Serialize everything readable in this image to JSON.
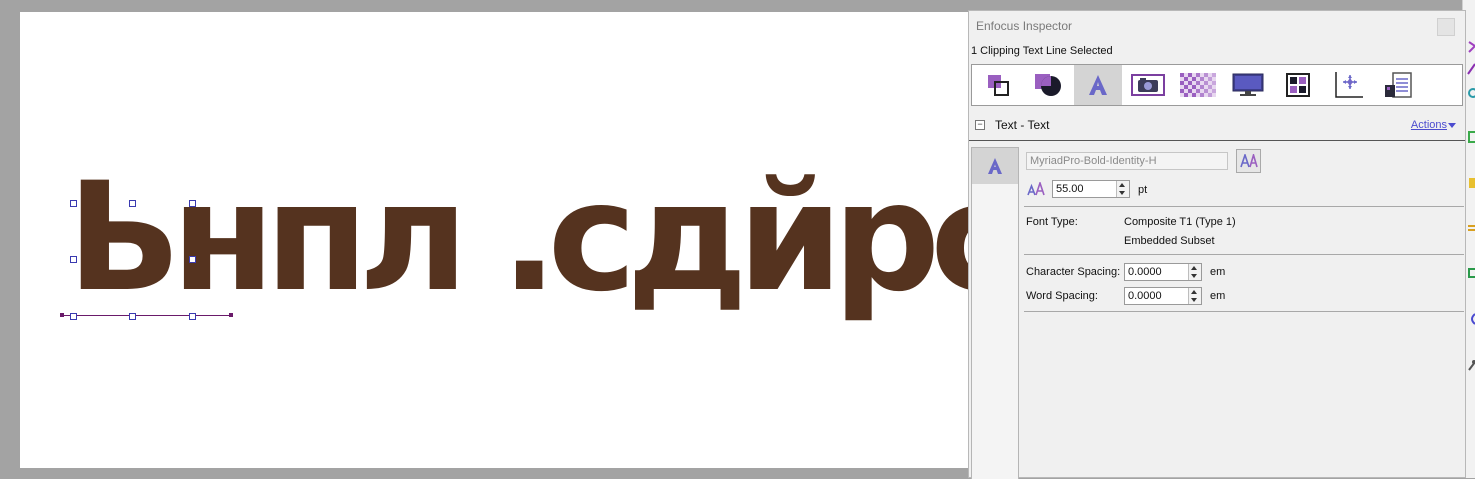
{
  "document": {
    "text": "Ьнпл .сдйрс",
    "text_color": "#55331f"
  },
  "inspector": {
    "title": "Enfocus Inspector",
    "selection_info": "1 Clipping Text Line Selected",
    "tabs": [
      {
        "name": "object-icon"
      },
      {
        "name": "fill-stroke-icon"
      },
      {
        "name": "text-icon",
        "active": true
      },
      {
        "name": "image-icon"
      },
      {
        "name": "transparency-icon"
      },
      {
        "name": "monitor-icon"
      },
      {
        "name": "color-icon"
      },
      {
        "name": "position-icon"
      },
      {
        "name": "properties-icon"
      }
    ],
    "section": {
      "title": "Text - Text",
      "collapse_symbol": "−",
      "actions_label": "Actions"
    },
    "side_tab_glyph": "A",
    "font": {
      "name": "MyriadPro-Bold-Identity-H",
      "size": "55.00",
      "size_unit": "pt",
      "type_label": "Font Type:",
      "type_value": "Composite T1 (Type 1)",
      "embedding": "Embedded Subset"
    },
    "spacing": {
      "character_label": "Character Spacing:",
      "character_value": "0.0000",
      "character_unit": "em",
      "word_label": "Word Spacing:",
      "word_value": "0.0000",
      "word_unit": "em"
    }
  },
  "colors": {
    "accent": "#4c4ccf",
    "purple": "#7b3fa0",
    "workspace": "#a3a3a3"
  }
}
